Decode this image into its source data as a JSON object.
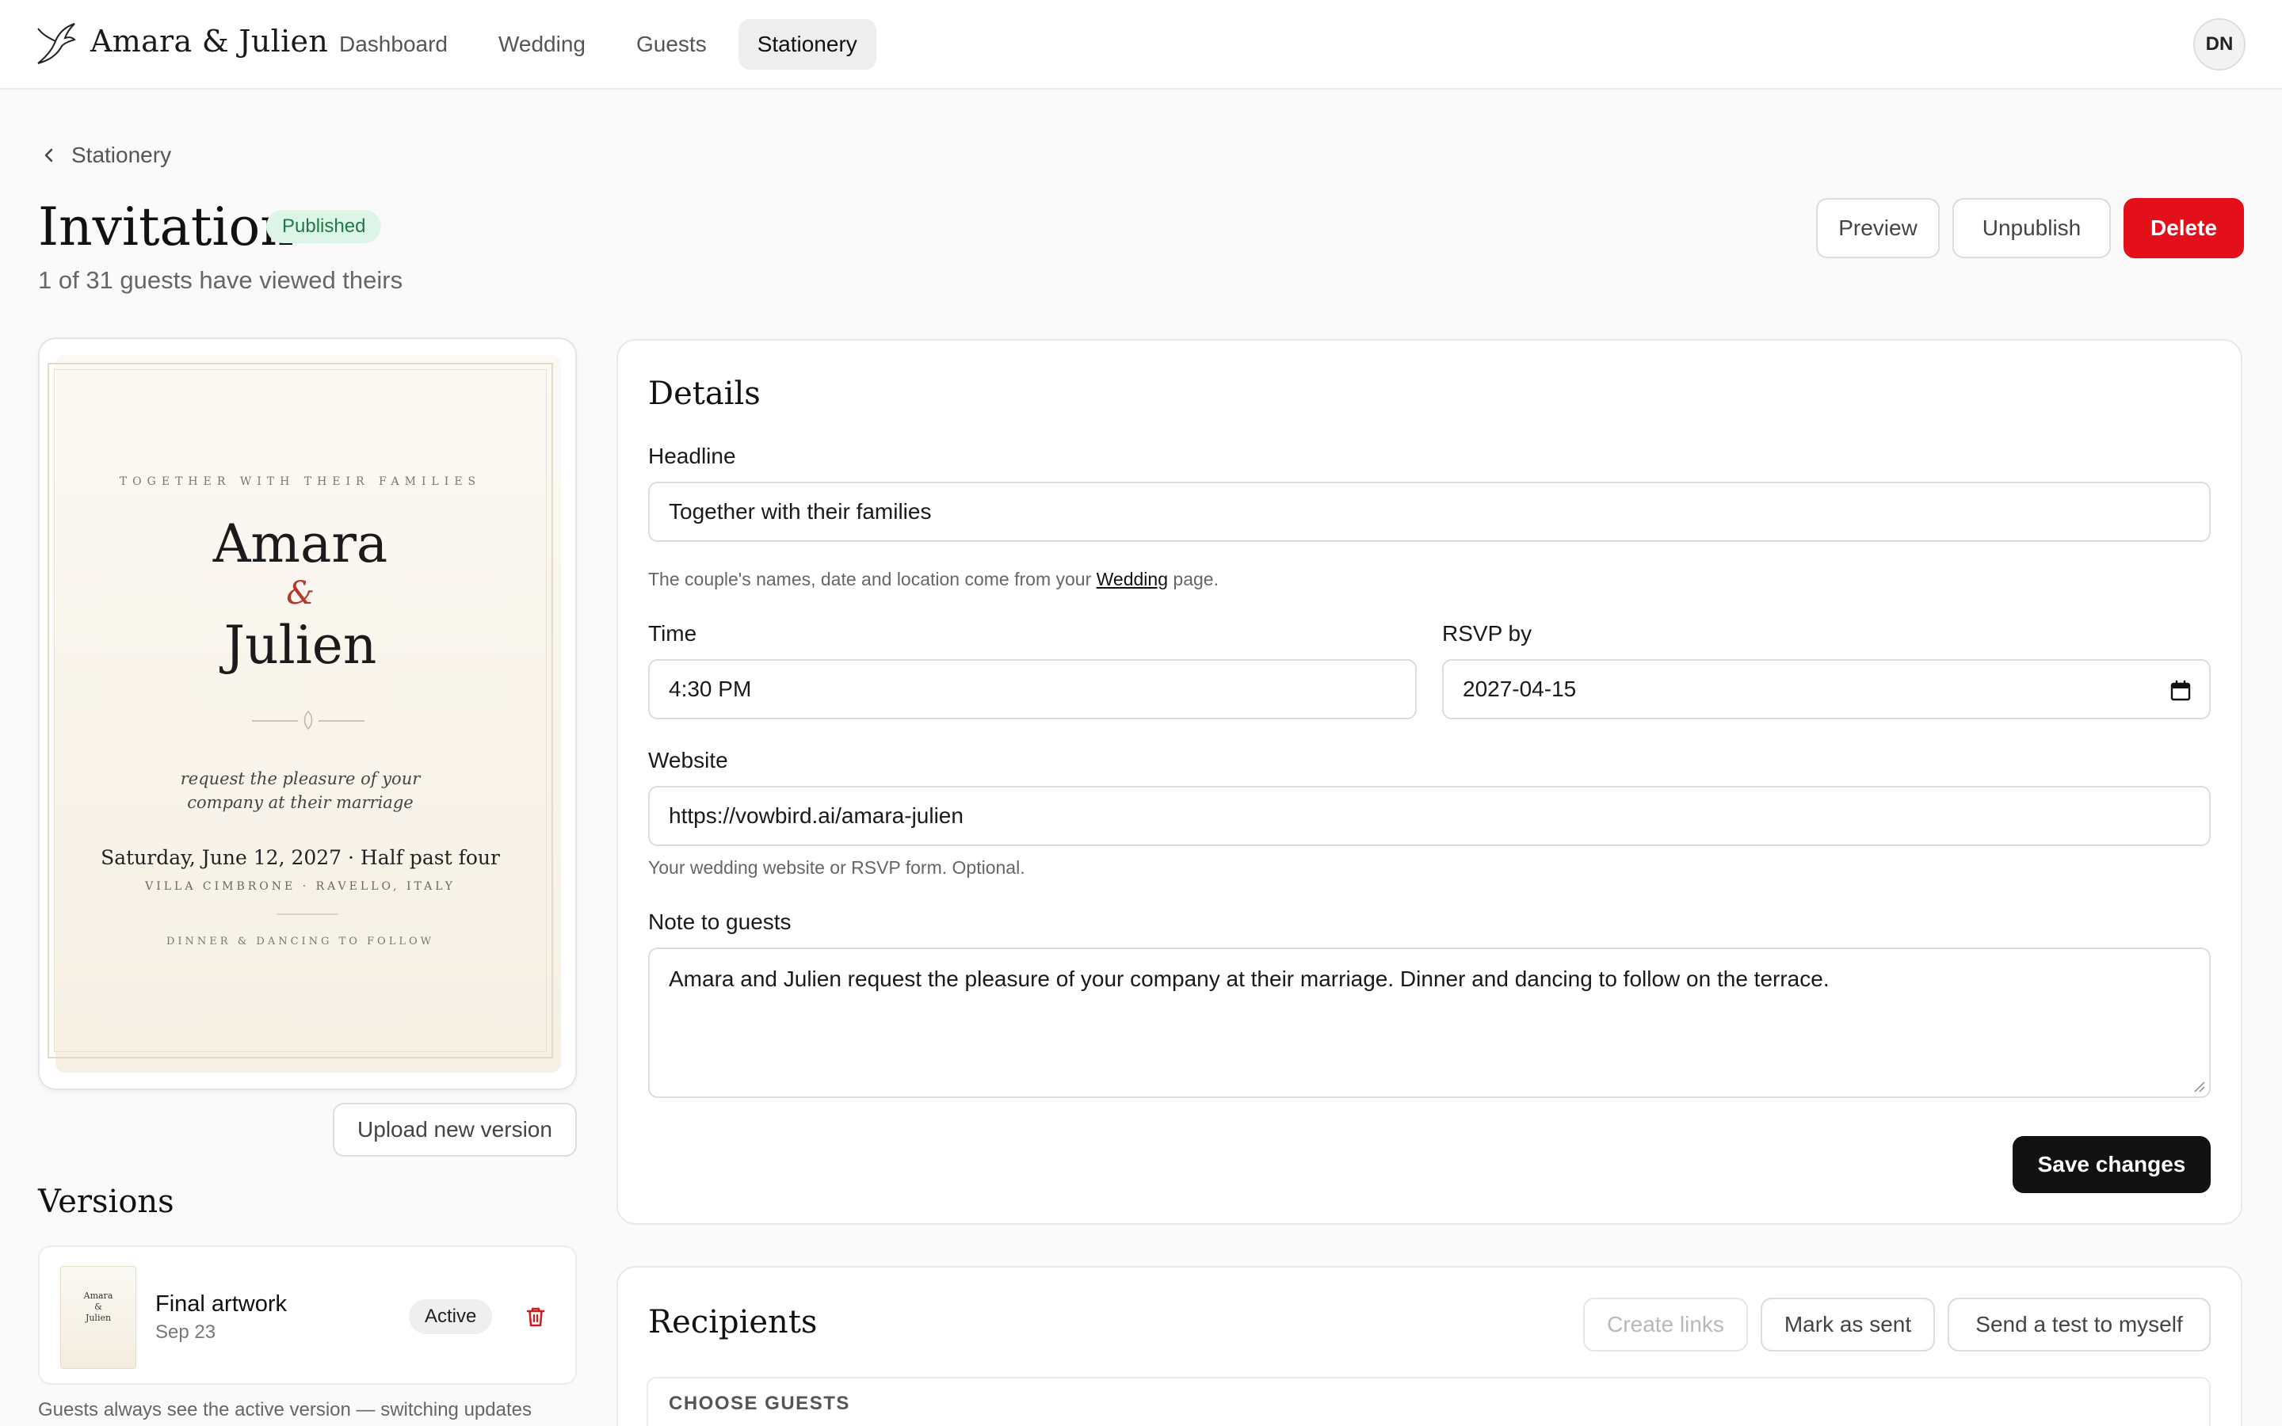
{
  "app": {
    "brand": "Amara & Julien",
    "user_initials": "DN",
    "nav": [
      "Dashboard",
      "Wedding",
      "Guests",
      "Stationery"
    ],
    "active_nav": "Stationery"
  },
  "breadcrumb": {
    "back_label": "Stationery"
  },
  "header": {
    "title": "Invitation",
    "status_badge": "Published",
    "subtitle": "1 of 31 guests have viewed theirs",
    "preview_button": "Preview",
    "unpublish_button": "Unpublish",
    "delete_button": "Delete"
  },
  "invitation_preview": {
    "overline": "TOGETHER WITH THEIR FAMILIES",
    "name1": "Amara",
    "ampersand": "&",
    "name2": "Julien",
    "request": "request the pleasure of your company at their marriage",
    "date_time": "Saturday, June 12, 2027 · Half past four",
    "venue": "VILLA CIMBRONE · RAVELLO, ITALY",
    "footer": "DINNER & DANCING TO FOLLOW"
  },
  "upload_button": "Upload new version",
  "versions": {
    "title": "Versions",
    "items": [
      {
        "name": "Final artwork",
        "date": "Sep 23",
        "status": "Active"
      }
    ],
    "helper": "Guests always see the active version — switching updates"
  },
  "details": {
    "title": "Details",
    "headline_label": "Headline",
    "headline_value": "Together with their families",
    "headline_help_prefix": "The couple's names, date and location come from your ",
    "headline_help_link": "Wedding",
    "headline_help_suffix": " page.",
    "time_label": "Time",
    "time_value": "4:30 PM",
    "rsvp_label": "RSVP by",
    "rsvp_value": "2027-04-15",
    "website_label": "Website",
    "website_value": "https://vowbird.ai/amara-julien",
    "website_help": "Your wedding website or RSVP form. Optional.",
    "note_label": "Note to guests",
    "note_value": "Amara and Julien request the pleasure of your company at their marriage. Dinner and dancing to follow on the terrace.",
    "save_button": "Save changes"
  },
  "recipients": {
    "title": "Recipients",
    "create_links_button": "Create links",
    "mark_sent_button": "Mark as sent",
    "send_test_button": "Send a test to myself",
    "choose_label": "CHOOSE GUESTS"
  },
  "colors": {
    "danger": "#e3101b",
    "published_bg": "#dcf5e6",
    "published_text": "#1d7a45",
    "accent_dark": "#121212"
  },
  "icons": [
    "hummingbird-logo-icon",
    "chevron-left-icon",
    "calendar-icon",
    "trash-icon",
    "resize-handle-icon"
  ]
}
